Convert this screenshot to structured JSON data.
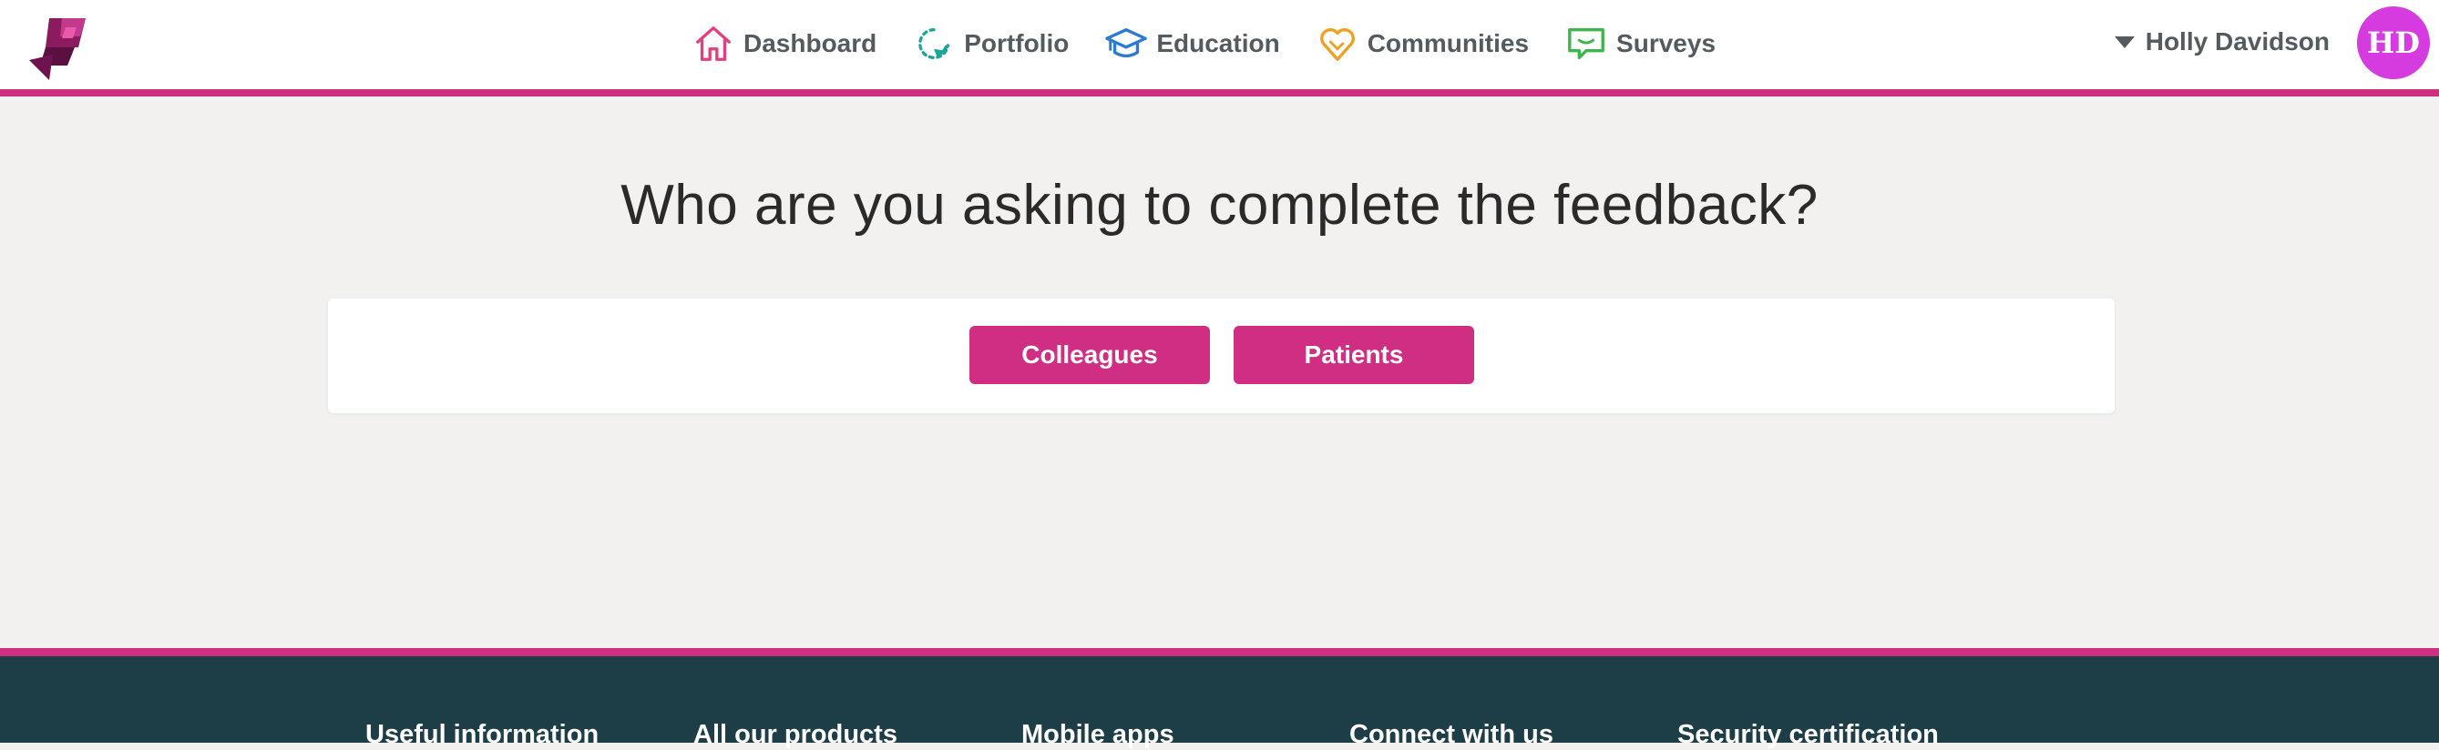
{
  "nav": {
    "items": [
      {
        "label": "Dashboard",
        "icon": "house-icon",
        "color": "#e0407f"
      },
      {
        "label": "Portfolio",
        "icon": "refresh-cycle-icon",
        "color": "#1aa79a"
      },
      {
        "label": "Education",
        "icon": "graduation-cap-icon",
        "color": "#2b7bd6"
      },
      {
        "label": "Communities",
        "icon": "heart-icon",
        "color": "#f0a020"
      },
      {
        "label": "Surveys",
        "icon": "speech-bubble-icon",
        "color": "#3cb54a"
      }
    ]
  },
  "user": {
    "name": "Holly Davidson",
    "initials": "HD"
  },
  "main": {
    "heading": "Who are you asking to complete the feedback?",
    "options": [
      {
        "label": "Colleagues"
      },
      {
        "label": "Patients"
      }
    ]
  },
  "footer": {
    "columns": [
      {
        "title": "Useful information"
      },
      {
        "title": "All our products"
      },
      {
        "title": "Mobile apps"
      },
      {
        "title": "Connect with us"
      },
      {
        "title": "Security certification"
      }
    ]
  },
  "colors": {
    "accent": "#cf2e82",
    "footer_bg": "#1e3e47",
    "avatar_bg": "#d63be0",
    "page_bg": "#f3f1ef"
  }
}
